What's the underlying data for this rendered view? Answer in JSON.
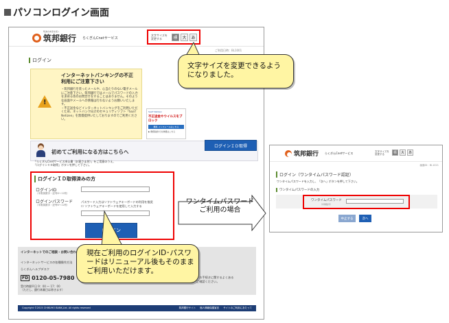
{
  "heading": "パソコンログイン画面",
  "main": {
    "bank_small": "筑波の未来を拓く",
    "bank_name": "筑邦銀行",
    "service_name": "らくぎんCnetサービス",
    "fontsize_label": "文字サイズを変更する",
    "fontsize_buttons": [
      "標",
      "大",
      "あ"
    ],
    "date_text": "ご利用日時：BL1001",
    "login_title": "ログイン",
    "warning_title": "インターネットバンキングの不正利用にご注意下さい",
    "warning_body": "・筑邦銀行を装ったメールや、心当たりのない電子メールにご注意下さい。筑邦銀行ではメールでパスワードの入力を求める等のお問合せをすることはありません。そのような画面やメールへの情報は行わないようお願いいたします。\n・不正送金などインターネットバンキングをご利用いただくため、ネットバンク向けのセキュリティソフト「SaaT Netizen」を無償提供いたしておりますのでご利用ください。",
    "ad_small": "SaaT Netizen",
    "ad_title": "不正送金やウイルスをブロック",
    "ad_button": "無料 インストールはこちら",
    "ad_foot": "▶ 無償提供での詳細はこちら",
    "first_time": "初めてご利用になる方はこちらへ",
    "id_button": "ログインＩＤ取得",
    "first_note": "「らくぎんCnetサービス申込書（お客さま控）」をご用意のうえ、\n「ログインＩＤ取得」ボタンを押して下さい。",
    "login_section": "ログインＩＤ取得済みの方",
    "login_id_label": "ログインID",
    "login_id_sub": "（半角英数字・記号6～12桁）",
    "password_label": "ログインパスワード",
    "password_sub": "（半角英数字・記号6～12桁）",
    "keyboard_text": "パスワード入力はソフトウェアキーボードの利用を推奨\n☐ ソフトウェアキーボードを使用して入力する",
    "login_button": "ログイン",
    "contact_heading": "インターネットでのご相談・お問い合わせ",
    "contact_line1": "インターネットサービスの各種操作方法",
    "contact_line2": "らくぎんヘルプデスク",
    "phone": "0120-05-7980",
    "hours": "受付時間平日 9：00 ～ 17：00\n（ただし、銀行休業日は除きます）",
    "contact_right1": "・お手続きに関するよくある",
    "contact_right2": "ご確認ください。",
    "footer_copy": "Copyright ©2015 CHIKUHO BANK,Ltd. All rights reserved",
    "footer_links": [
      "筑邦銀行サイト",
      "個人情報保護宣言",
      "サイトのご利用にあたって"
    ]
  },
  "callouts": {
    "fontsize": "文字サイズを変更できるようになりました。",
    "login_id": "現在ご利用のログインID･パスワードはリニューアル後もそのままご利用いただけます。",
    "otp_arrow": "ワンタイムパスワードご利用の場合"
  },
  "otp": {
    "bank_name": "筑邦銀行",
    "service_name": "らくぎんCnetサービス",
    "fontsize_label": "文字サイズを変更する",
    "fontsize_buttons": [
      "標",
      "大",
      "あ"
    ],
    "date_text": "画面ID：BL1021",
    "title": "ログイン（ワンタイムパスワード認証）",
    "desc": "ワンタイムパスワードを入力し、「次へ」ボタンを押して下さい。",
    "section": "ワンタイムパスワードの入力",
    "field_label": "ワンタイムパスワード",
    "field_sub": "（半角数字）",
    "back_button": "中止する",
    "next_button": "次へ"
  },
  "colors": {
    "highlight": "#e00000",
    "callout": "#fff5a3",
    "button": "#1e5fb4",
    "footer": "#1d3d75"
  }
}
